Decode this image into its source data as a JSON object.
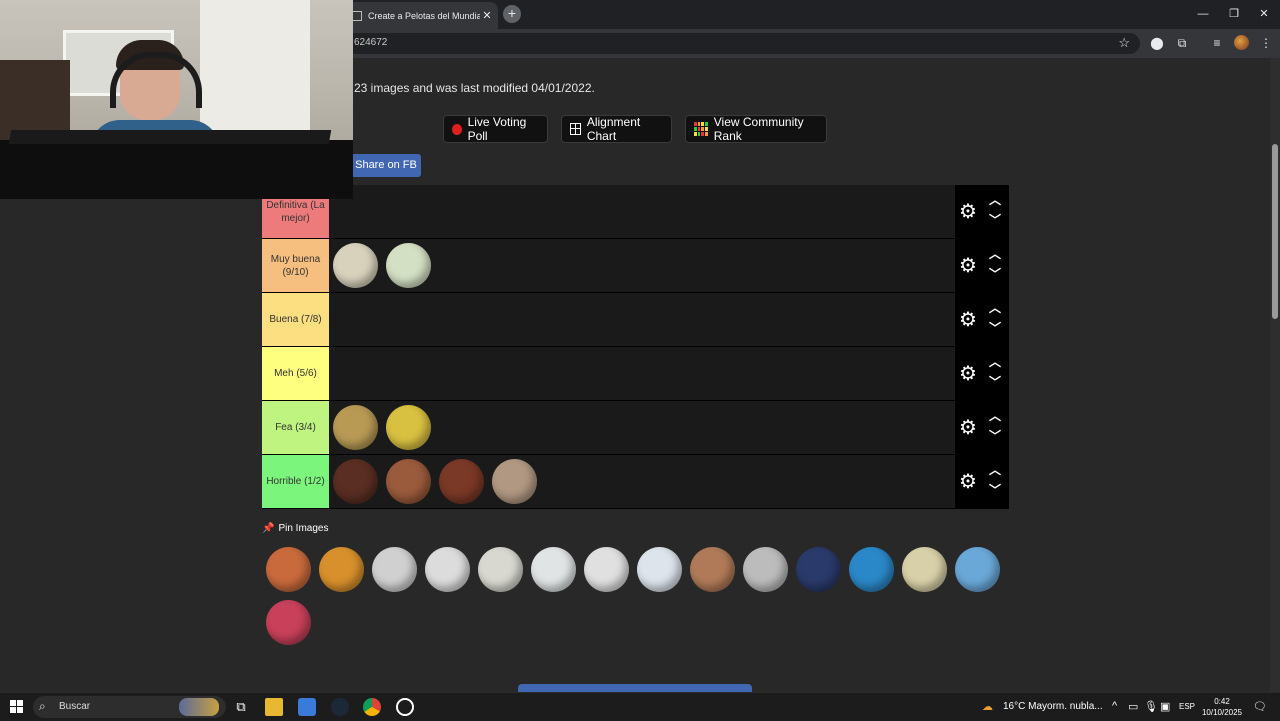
{
  "browser": {
    "tab_title": "Create a Pelotas del Mundial (U",
    "url_fragment": "624672",
    "new_tab": "+",
    "tab_close": "✕"
  },
  "page": {
    "info_text": "23 images and was last modified 04/01/2022.",
    "buttons": {
      "live_poll": "Live Voting Poll",
      "alignment": "Alignment Chart",
      "community": "View Community Rank"
    },
    "share_fb": "Share on FB",
    "pin_label": "Pin Images"
  },
  "tiers": [
    {
      "label": "Definitiva (La mejor)",
      "color": "#ee7b7c",
      "items": []
    },
    {
      "label": "Muy buena (9/10)",
      "color": "#f6be7f",
      "items": [
        "#d8d2bc",
        "#d4e0c4"
      ]
    },
    {
      "label": "Buena (7/8)",
      "color": "#fbdf80",
      "items": []
    },
    {
      "label": "Meh (5/6)",
      "color": "#fefe7f",
      "items": []
    },
    {
      "label": "Fea (3/4)",
      "color": "#bef47f",
      "items": [
        "#b89a54",
        "#d8c040"
      ]
    },
    {
      "label": "Horrible (1/2)",
      "color": "#7cf57c",
      "items": [
        "#5a2e22",
        "#9a5a3c",
        "#7a3826",
        "#b09882"
      ]
    }
  ],
  "pool_items": [
    "#c86a3c",
    "#d8902c",
    "#d0d0d0",
    "#dcdcdc",
    "#d8d8d0",
    "#e0e4e4",
    "#e0e0e0",
    "#dde4ec",
    "#b07a58",
    "#bcbcbc",
    "#2a3a6a",
    "#2a88c8",
    "#d8d0a8",
    "#6aa8d8",
    "#c8405a"
  ],
  "taskbar": {
    "search_placeholder": "Buscar",
    "weather": "16°C  Mayorm. nubla...",
    "lang": "ESP",
    "time": "0:42",
    "date": "10/10/2025"
  },
  "colors": {
    "fb_blue": "#4267b2",
    "page_bg": "#282828"
  },
  "icons": [
    "gear-icon",
    "chevron-up-icon",
    "chevron-down-icon",
    "pin-icon",
    "star-icon",
    "windows-start-icon",
    "search-icon"
  ]
}
